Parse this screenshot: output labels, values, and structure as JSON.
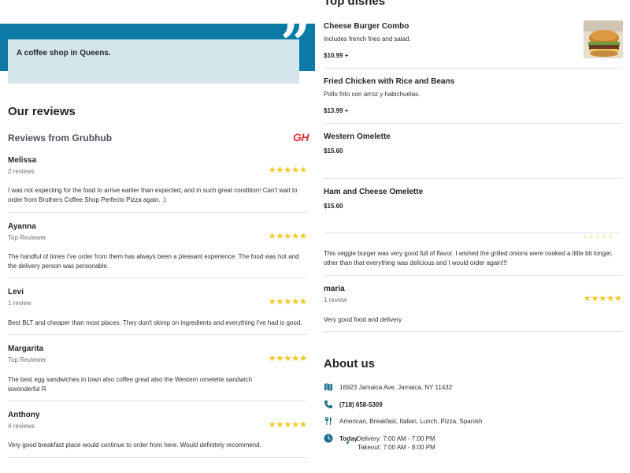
{
  "hero": {
    "description": "A coffee shop in Queens.",
    "quote_glyph": "”"
  },
  "reviews_section": {
    "title": "Our reviews",
    "source_heading": "Reviews from Grubhub",
    "source_logo": "GH",
    "items": [
      {
        "name": "Melissa",
        "meta": "2 reviews",
        "rating": 5,
        "text": "I was not expecting for the food to arrive earlier than expected, and in such great condition! Can't wait to order from Brothers Coffee Shop Perfecto Pizza again. :)"
      },
      {
        "name": "Ayanna",
        "meta": "Top Reviewer",
        "rating": 5,
        "text": "The handful of times I've order from them has always been a pleasant experience. The food was hot and the delivery person was personable."
      },
      {
        "name": "Levi",
        "meta": "1 review",
        "rating": 5,
        "text": "Best BLT and cheaper than most places. They don't skimp on ingredients and everything I've had is good."
      },
      {
        "name": "Margarita",
        "meta": "Top Reviewer",
        "rating": 5,
        "text": "The best egg sandwiches in town also coffee great also the Western omelette sandwich iswonderful R"
      },
      {
        "name": "Anthony",
        "meta": "4 reviews",
        "rating": 5,
        "text": "Very good breakfast place would continue to order from here. Would definitely recommend."
      }
    ]
  },
  "dishes_section": {
    "title": "Top dishes",
    "items": [
      {
        "name": "Cheese Burger Combo",
        "description": "Includes french fries and salad.",
        "price": "$10.99 +",
        "has_image": true
      },
      {
        "name": "Fried Chicken with Rice and Beans",
        "description": "Pollo frito con arroz y habichuelas.",
        "price": "$13.99 +",
        "has_image": false
      },
      {
        "name": "Western Omelette",
        "description": "",
        "price": "$15.60",
        "has_image": false
      },
      {
        "name": "Ham and Cheese Omelette",
        "description": "",
        "price": "$15.60",
        "has_image": false
      }
    ]
  },
  "side_reviews": {
    "snippet": "This veggie burger was very good full of flavor. I wished the grilled onions were cooked a little bit longer, other than that everything was delicious and I would order again!!!",
    "items": [
      {
        "name": "maria",
        "meta": "1 review",
        "rating": 5,
        "text": "Very good food and delivery"
      }
    ]
  },
  "about": {
    "title": "About us",
    "address": "16923 Jamaica Ave, Jamaica, NY 11432",
    "phone": "(718) 658-5309",
    "cuisines": "American, Breakfast, Italian, Lunch, Pizza, Spanish",
    "hours_day": "Today",
    "delivery_hours": "Delivery: 7:00 AM - 7:00 PM",
    "takeout_hours": "Takeout: 7:00 AM - 8:00 PM",
    "icons": [
      "map-icon",
      "phone-icon",
      "utensils-icon",
      "clock-icon",
      "chevron-down-icon"
    ]
  },
  "colors": {
    "brand_blue": "#0b7aa6",
    "card_tint": "#d5e5ec",
    "star_yellow": "#f5c518",
    "grubhub_red": "#e0313d",
    "icon_blue": "#1e6f8f"
  }
}
